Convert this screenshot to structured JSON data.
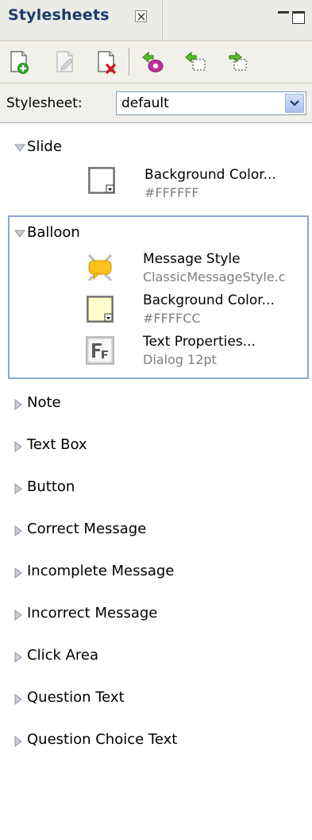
{
  "panel": {
    "title": "Stylesheets"
  },
  "toolbar": {
    "buttons": [
      {
        "name": "new-stylesheet-icon"
      },
      {
        "name": "edit-stylesheet-icon"
      },
      {
        "name": "delete-stylesheet-icon"
      },
      {
        "name": "apply-style-icon"
      },
      {
        "name": "import-style-icon"
      },
      {
        "name": "export-style-icon"
      }
    ]
  },
  "stylesheet": {
    "label": "Stylesheet:",
    "selected": "default"
  },
  "tree": {
    "slide": {
      "label": "Slide",
      "props": [
        {
          "name": "Background Color...",
          "value": "#FFFFFF"
        }
      ]
    },
    "balloon": {
      "label": "Balloon",
      "props": [
        {
          "name": "Message Style",
          "value": "ClassicMessageStyle.c"
        },
        {
          "name": "Background Color...",
          "value": "#FFFFCC"
        },
        {
          "name": "Text Properties...",
          "value": "Dialog 12pt"
        }
      ]
    },
    "collapsed": [
      "Note",
      "Text Box",
      "Button",
      "Correct Message",
      "Incomplete Message",
      "Incorrect Message",
      "Click Area",
      "Question Text",
      "Question Choice Text"
    ]
  },
  "colors": {
    "title": "#1c3a6d",
    "selection_border": "#8ba6d2",
    "slide_bg": "#FFFFFF",
    "balloon_bg": "#FFFFCC"
  }
}
